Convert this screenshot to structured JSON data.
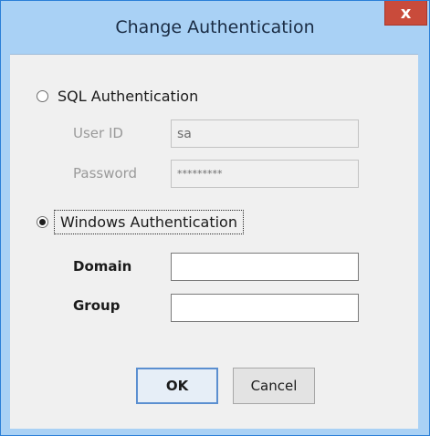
{
  "dialog": {
    "title": "Change Authentication",
    "close_glyph": "x"
  },
  "sql_auth": {
    "label": "SQL Authentication",
    "selected": false,
    "user_id_label": "User ID",
    "user_id_value": "sa",
    "password_label": "Password",
    "password_value": "*********"
  },
  "windows_auth": {
    "label": "Windows Authentication",
    "selected": true,
    "domain_label": "Domain",
    "domain_value": "",
    "group_label": "Group",
    "group_value": ""
  },
  "buttons": {
    "ok": "OK",
    "cancel": "Cancel"
  },
  "colors": {
    "title_bar": "#a9d1f5",
    "close_button": "#c94b3b",
    "client_background": "#f0f0f0"
  }
}
